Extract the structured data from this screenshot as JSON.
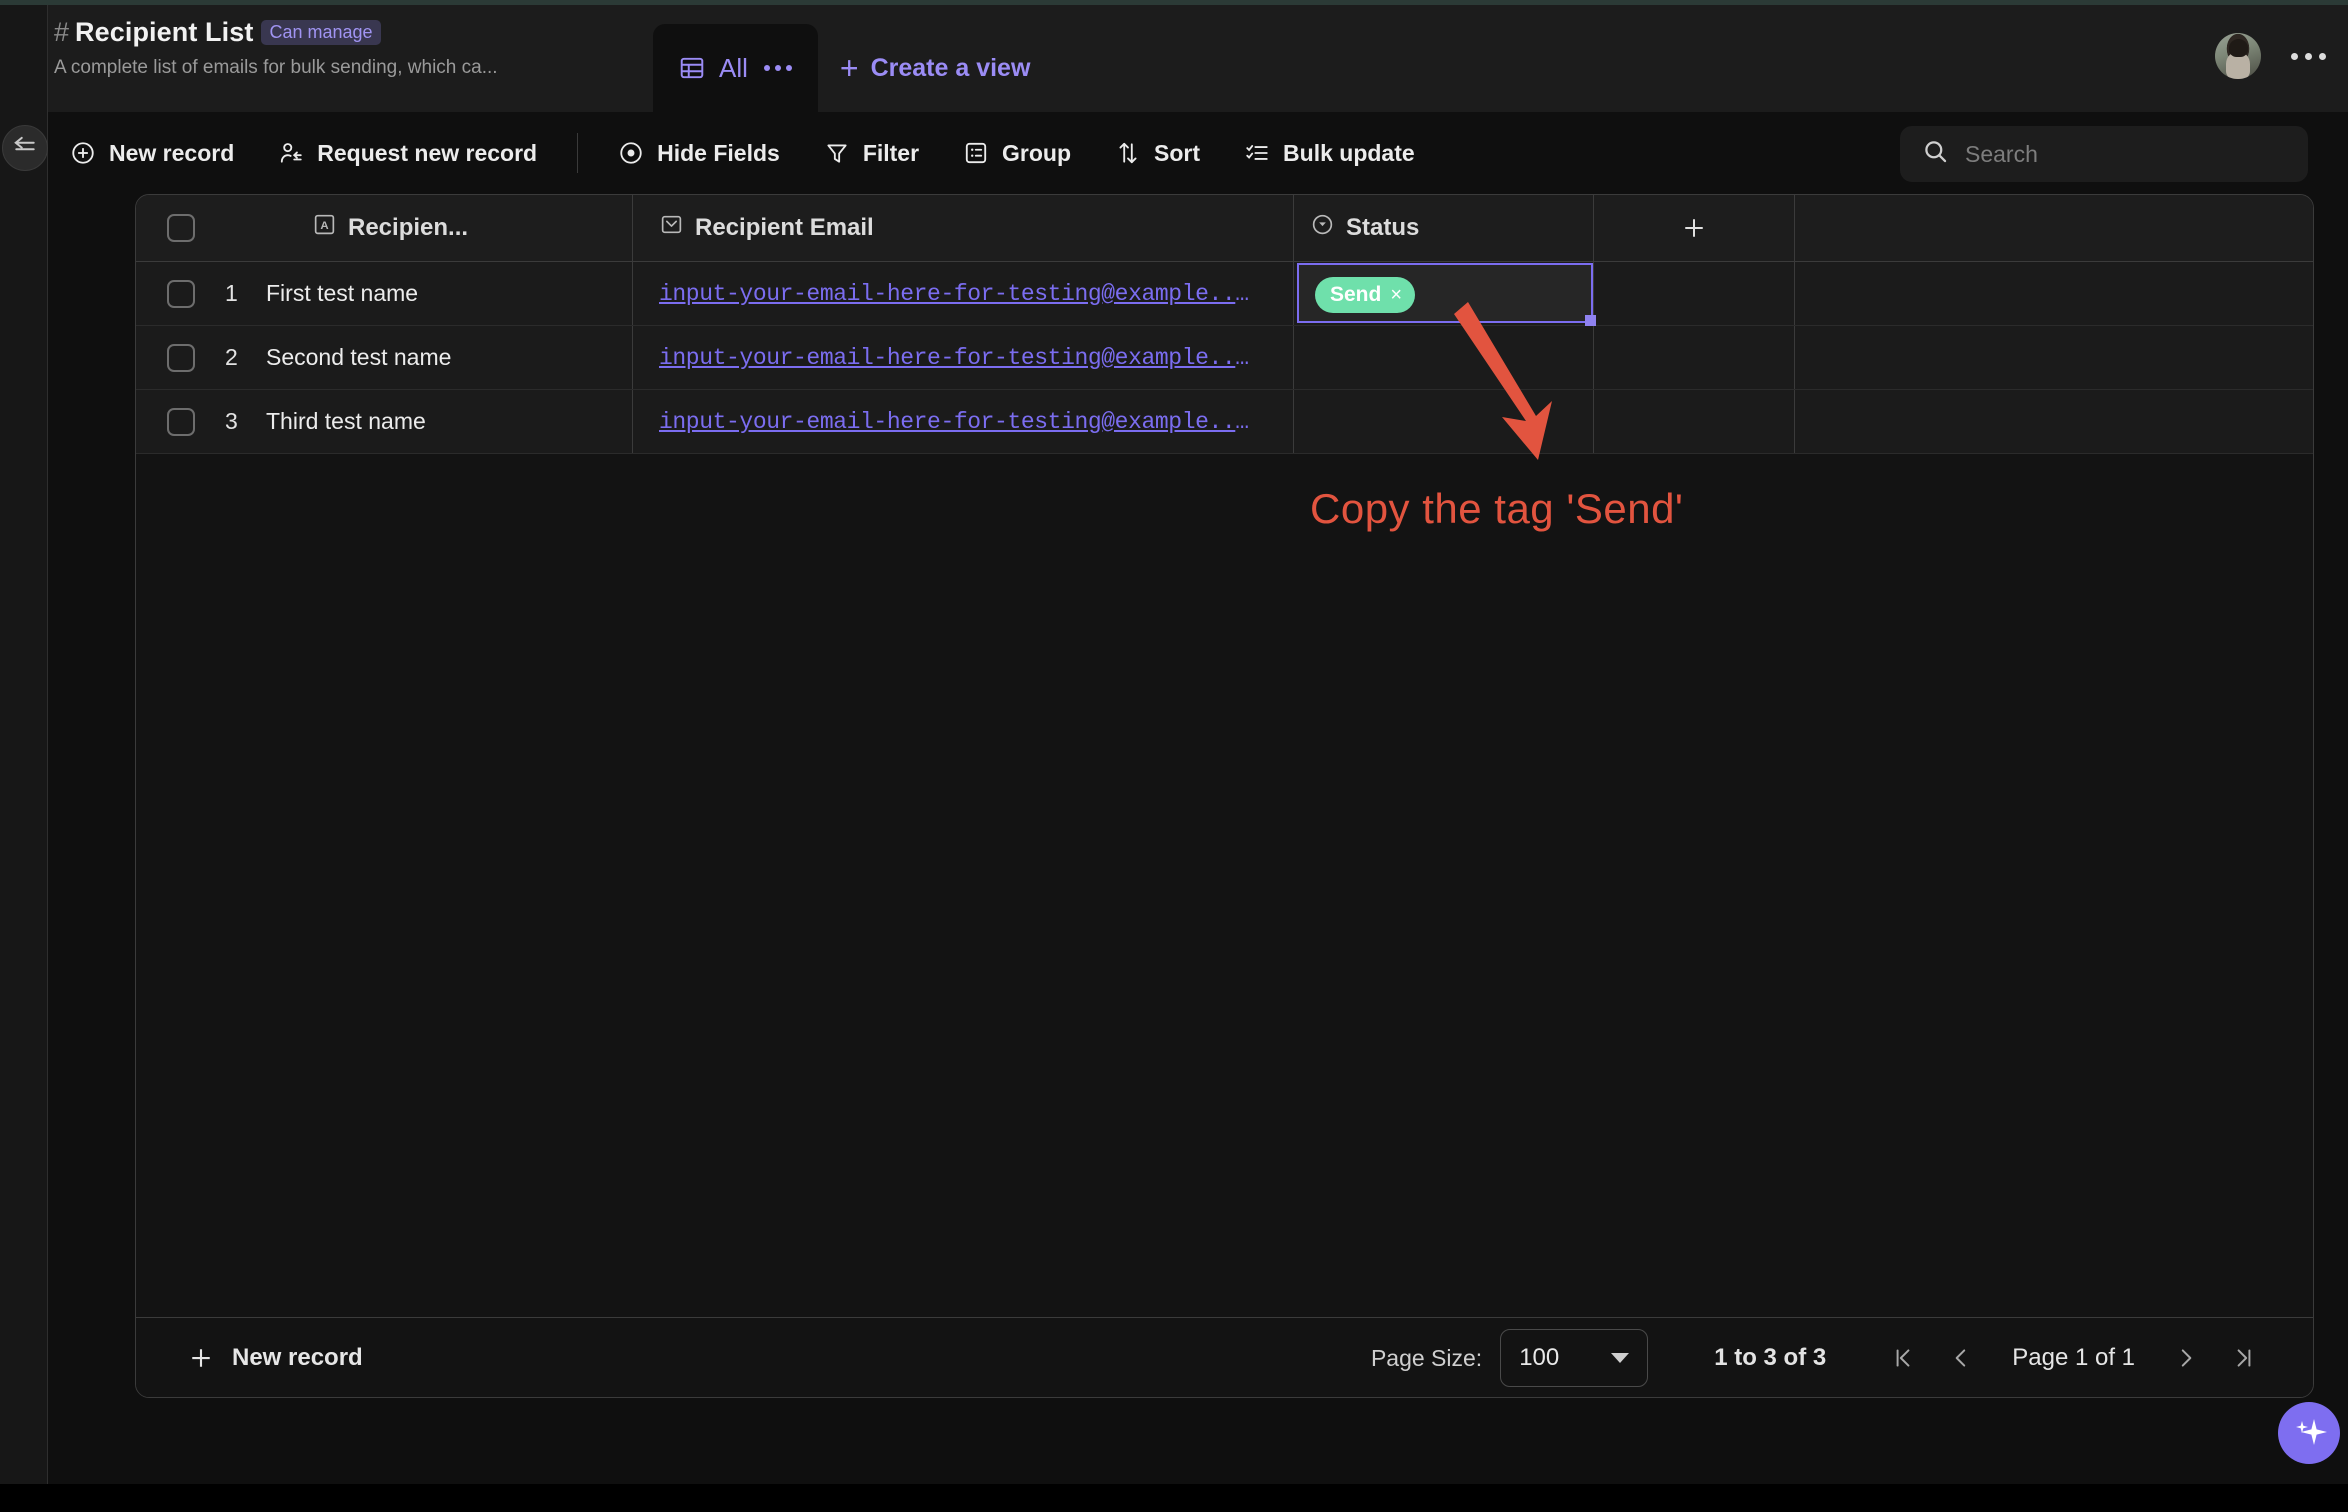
{
  "header": {
    "hash_icon": "hash-icon",
    "title": "Recipient List",
    "permission_badge": "Can manage",
    "description": "A complete list of emails for bulk sending, which ca...",
    "tabs": [
      {
        "label": "All",
        "icon": "grid-table-icon",
        "active": true
      }
    ],
    "create_view_label": "Create a view",
    "avatar": "user-avatar",
    "more_menu": "kebab-menu-icon"
  },
  "sidebar": {
    "collapse_label": "collapse-sidebar"
  },
  "toolbar": {
    "items": [
      {
        "label": "New record",
        "icon": "plus-circle-icon"
      },
      {
        "label": "Request new record",
        "icon": "person-request-icon"
      },
      {
        "label": "Hide Fields",
        "icon": "eye-icon"
      },
      {
        "label": "Filter",
        "icon": "funnel-icon"
      },
      {
        "label": "Group",
        "icon": "group-list-icon"
      },
      {
        "label": "Sort",
        "icon": "sort-arrows-icon"
      },
      {
        "label": "Bulk update",
        "icon": "bulk-list-icon"
      }
    ],
    "search": {
      "placeholder": "Search",
      "value": "",
      "icon": "search-icon"
    }
  },
  "table": {
    "columns": [
      {
        "label": "Recipien...",
        "icon": "text-field-icon"
      },
      {
        "label": "Recipient Email",
        "icon": "email-field-icon"
      },
      {
        "label": "Status",
        "icon": "select-field-icon"
      }
    ],
    "add_field_icon": "plus-icon",
    "rows": [
      {
        "index": "1",
        "name": "First test name",
        "email": "input-your-email-here-for-testing@example....",
        "status_tag": "Send",
        "status_selected": true
      },
      {
        "index": "2",
        "name": "Second test name",
        "email": "input-your-email-here-for-testing@example....",
        "status_tag": "",
        "status_selected": false
      },
      {
        "index": "3",
        "name": "Third test name",
        "email": "input-your-email-here-for-testing@example....",
        "status_tag": "",
        "status_selected": false
      }
    ],
    "tag_remove_glyph": "×"
  },
  "footer": {
    "new_record_label": "New record",
    "new_record_icon": "plus-icon",
    "page_size_label": "Page Size:",
    "page_size_value": "100",
    "range_text": "1 to 3 of 3",
    "page_text": "Page 1 of 1",
    "first_icon": "first-page-icon",
    "prev_icon": "prev-page-icon",
    "next_icon": "next-page-icon",
    "last_icon": "last-page-icon"
  },
  "annotation": {
    "text": "Copy the tag 'Send'",
    "color": "#e2543f",
    "arrow": "down-right-arrow"
  },
  "ai_button": {
    "icon": "sparkle-icon",
    "color": "#7e6ef0"
  },
  "colors": {
    "accent_purple": "#7b6df0",
    "tag_green": "#6fe0ab",
    "annotation_red": "#e2543f",
    "background": "#0f0f0f"
  }
}
